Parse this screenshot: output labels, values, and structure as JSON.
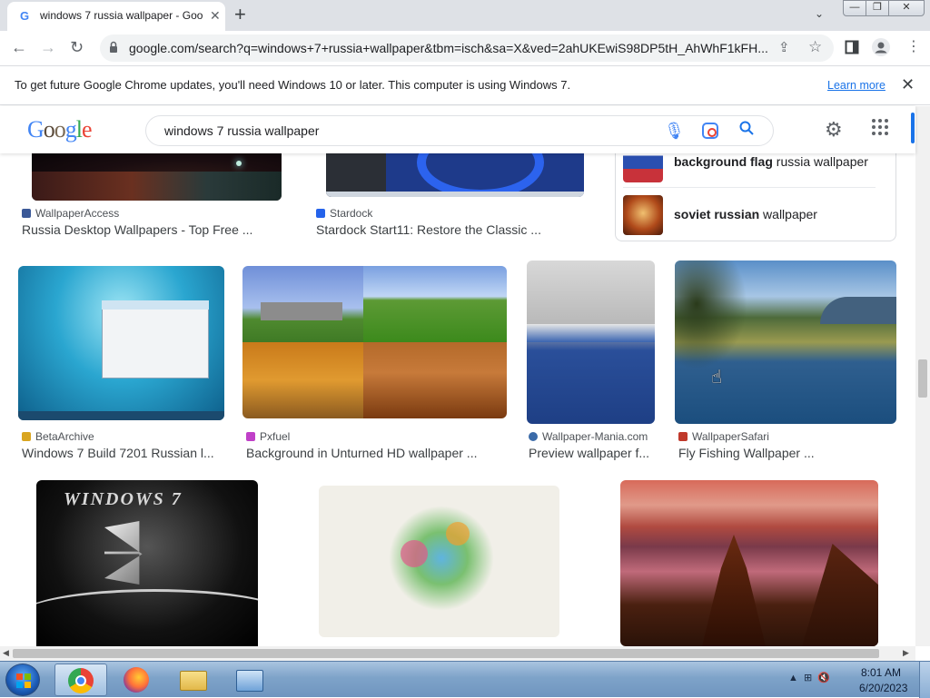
{
  "browser": {
    "tab_title": "windows 7 russia wallpaper - Goo",
    "new_tab": "+",
    "url": "google.com/search?q=windows+7+russia+wallpaper&tbm=isch&sa=X&ved=2ahUKEwiS98DP5tH_AhWhF1kFH...",
    "window_buttons": {
      "min": "—",
      "max": "❐",
      "close": "✕"
    }
  },
  "infobar": {
    "message": "To get future Google Chrome updates, you'll need Windows 10 or later. This computer is using Windows 7.",
    "link": "Learn more",
    "close": "✕"
  },
  "google": {
    "logo": "Google",
    "query": "windows 7 russia wallpaper"
  },
  "related": [
    {
      "bold": "background flag",
      "rest": " russia wallpaper"
    },
    {
      "bold": "soviet russian",
      "rest": " wallpaper"
    }
  ],
  "results_row1": [
    {
      "source": "WallpaperAccess",
      "title": "Russia Desktop Wallpapers - Top Free ..."
    },
    {
      "source": "Stardock",
      "title": "Stardock Start11: Restore the Classic ..."
    }
  ],
  "results_row2": [
    {
      "source": "BetaArchive",
      "title": "Windows 7 Build 7201 Russian l..."
    },
    {
      "source": "Pxfuel",
      "title": "Background in Unturned HD wallpaper ..."
    },
    {
      "source": "Wallpaper-Mania.com",
      "title": "Preview wallpaper f..."
    },
    {
      "source": "WallpaperSafari",
      "title": "Fly Fishing Wallpaper ..."
    }
  ],
  "row3_image_text": "WINDOWS 7",
  "taskbar": {
    "time": "8:01 AM",
    "date": "6/20/2023"
  },
  "colors": {
    "accent": "#1a73e8",
    "link": "#1a73e8",
    "taskbar": "#7ea3c9"
  }
}
